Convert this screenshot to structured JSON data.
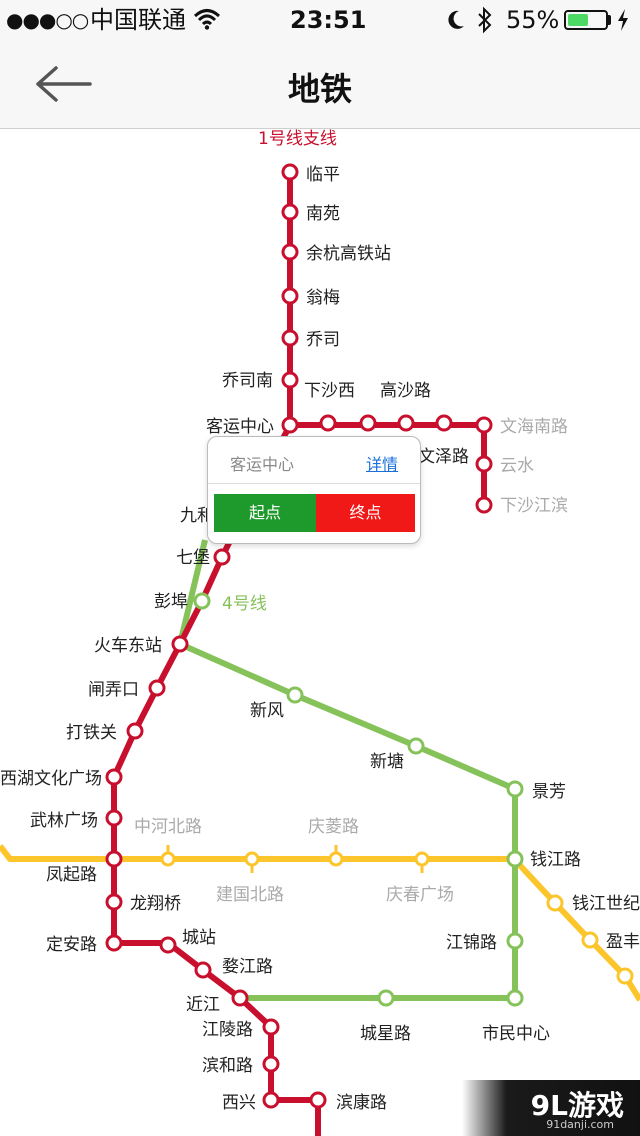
{
  "status_bar": {
    "signal": "●●●○○",
    "carrier": "中国联通",
    "wifi_icon": "wifi-icon",
    "time": "23:51",
    "moon_icon": "moon-icon",
    "bluetooth_icon": "bluetooth-icon",
    "battery": "55%",
    "battery_level": 0.55
  },
  "nav": {
    "back_icon": "arrow-left-icon",
    "title": "地铁"
  },
  "colors": {
    "line1": "#c8102e",
    "line2": "#fbc52b",
    "line4": "#86c25a",
    "inactive_text": "#aaaaaa",
    "start_button": "#1e9a2c",
    "end_button": "#f11818"
  },
  "line_labels": {
    "line1_branch": "1号线支线",
    "line4": "4号线"
  },
  "stations": {
    "linping": "临平",
    "nanyuan": "南苑",
    "yuhang_hsr": "余杭高铁站",
    "wengmei": "翁梅",
    "qiaosi": "乔司",
    "qiaosi_south": "乔司南",
    "kezhan": "客运中心",
    "xiasha_west": "下沙西",
    "gaosha": "高沙路",
    "wenze": "文泽路",
    "wenhai_south": "文海南路",
    "yunshui": "云水",
    "xiasha_jiangbin": "下沙江滨",
    "jiubao": "九和",
    "qibao": "七堡",
    "pengbu": "彭埠",
    "huochedong": "火车东站",
    "zhanongkou": "闸弄口",
    "datieguan": "打铁关",
    "xihu_wenhua": "西湖文化广场",
    "wulin": "武林广场",
    "fengqi": "凤起路",
    "longxiangqiao": "龙翔桥",
    "dinganlu": "定安路",
    "chengzhan": "城站",
    "wujianglu": "婺江路",
    "jinjiang": "近江",
    "jianglinglu": "江陵路",
    "binhelu": "滨和路",
    "xixing": "西兴",
    "binkanglu": "滨康路",
    "xinfeng": "新风",
    "xintang": "新塘",
    "jingfang": "景芳",
    "qianjianglu": "钱江路",
    "jiangjinlu": "江锦路",
    "shimin": "市民中心",
    "chengxinglu": "城星路",
    "zhonghe_north": "中河北路",
    "qinglingjie": "庆菱路",
    "jianguo_north": "建国北路",
    "qingchun_square": "庆春广场",
    "qianjiang_century": "钱江世纪",
    "yingfeng": "盈丰"
  },
  "popup": {
    "station": "客运中心",
    "detail": "详情",
    "start": "起点",
    "end": "终点"
  },
  "watermark": {
    "logo": "9L游戏",
    "url": "91danji.com"
  }
}
